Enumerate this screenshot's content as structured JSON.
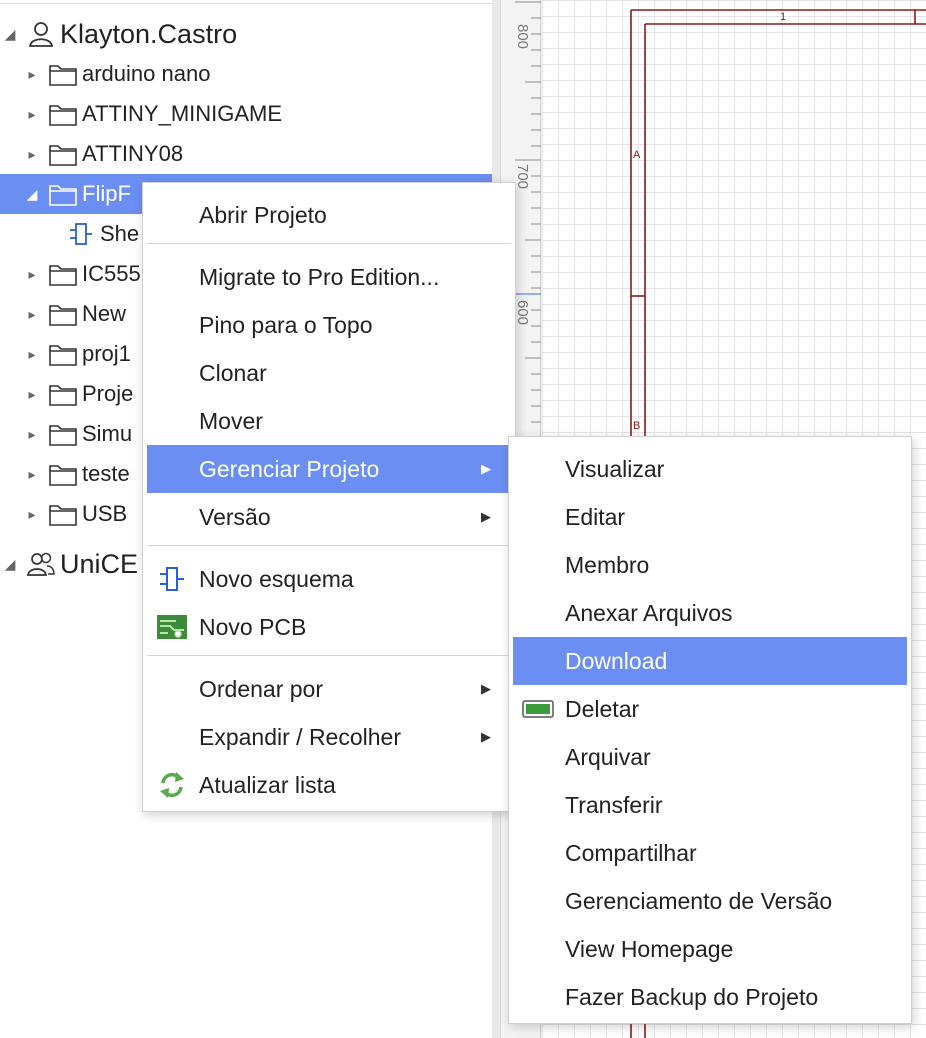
{
  "tree": {
    "root_user": "Klayton.Castro",
    "items": [
      {
        "label": "arduino nano"
      },
      {
        "label": "ATTINY_MINIGAME"
      },
      {
        "label": "ATTINY08"
      },
      {
        "label": "FlipF"
      },
      {
        "label": "She"
      },
      {
        "label": "IC555"
      },
      {
        "label": "New"
      },
      {
        "label": "proj1"
      },
      {
        "label": "Proje"
      },
      {
        "label": "Simu"
      },
      {
        "label": "teste"
      },
      {
        "label": "USB"
      }
    ],
    "root_team": "UniCE"
  },
  "ruler": {
    "labels": [
      "800",
      "700",
      "600"
    ]
  },
  "schematic": {
    "col_label": "1",
    "row_labels": [
      "A",
      "B"
    ]
  },
  "context_menu": {
    "open_project": "Abrir Projeto",
    "migrate": "Migrate to Pro Edition...",
    "pin_top": "Pino para o Topo",
    "clone": "Clonar",
    "move": "Mover",
    "manage": "Gerenciar Projeto",
    "version": "Versão",
    "new_schematic": "Novo esquema",
    "new_pcb": "Novo PCB",
    "sort_by": "Ordenar por",
    "expand_collapse": "Expandir / Recolher",
    "refresh": "Atualizar lista"
  },
  "submenu": {
    "items": [
      "Visualizar",
      "Editar",
      "Membro",
      "Anexar Arquivos",
      "Download",
      "Deletar",
      "Arquivar",
      "Transferir",
      "Compartilhar",
      "Gerenciamento de Versão",
      "View Homepage",
      "Fazer Backup do Projeto"
    ]
  },
  "colors": {
    "highlight": "#6a8ef2",
    "schematic_frame": "#8b1a1a"
  }
}
